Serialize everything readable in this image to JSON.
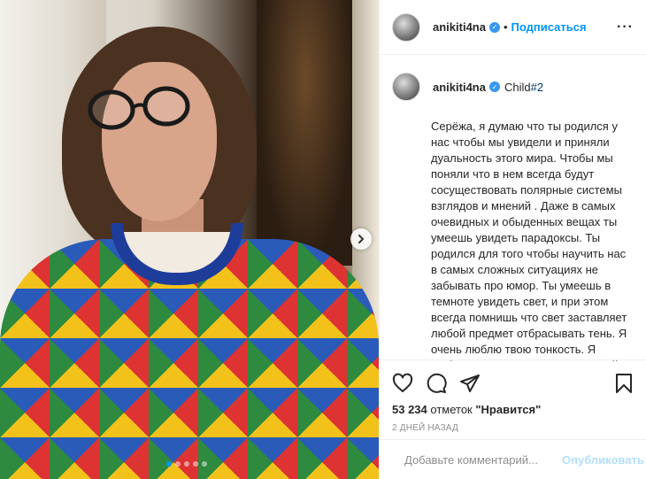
{
  "header": {
    "username": "anikiti4na",
    "separator": "•",
    "follow_label": "Подписаться",
    "more_label": "···"
  },
  "caption": {
    "username": "anikiti4na",
    "tag_prefix": "Child",
    "tag_hash": "#2",
    "text": "Серёжа, я думаю что ты родился у\nнас чтобы мы увидели и приняли\nдуальность этого мира. Чтобы мы\nпоняли что в нем всегда будут\nсосуществовать полярные системы\nвзглядов и мнений . Даже в самых\nочевидных и обыденных вещах ты\nумеешь увидеть парадоксы. Ты\nродился для того чтобы научить нас\nв самых сложных ситуациях не\nзабывать про юмор. Ты умеешь в\nтемноте увидеть свет, и при этом\nвсегда помнишь что свет заставляет\nлюбой предмет отбрасывать тень. Я\nочень люблю твою тонкость. Я\nлюблю твою точность оценок, твой\nзамечательный юмор, твою\nнепосредственность. И в тоже"
  },
  "likes": {
    "count": "53 234",
    "middle": " отметок ",
    "label": "\"Нравится\""
  },
  "timestamp": "2 ДНЕЙ НАЗАД",
  "comment": {
    "placeholder": "Добавьте комментарий...",
    "publish_label": "Опубликовать"
  },
  "carousel": {
    "total": 5,
    "active": 0
  },
  "icons": {
    "like": "heart-icon",
    "comment": "comment-icon",
    "share": "share-icon",
    "save": "bookmark-icon",
    "emoji": "smile-icon",
    "next": "chevron-right-icon",
    "verified": "verified-badge-icon"
  },
  "colors": {
    "accent": "#0095f6",
    "verified": "#3897f0",
    "publish_disabled": "#b2dffc"
  }
}
